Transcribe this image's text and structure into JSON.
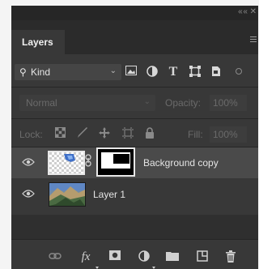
{
  "panel": {
    "title": "Layers",
    "collapse_icon": "double-chevron-right-icon",
    "menu_icon": "hamburger-icon"
  },
  "filter": {
    "kind_label": "Kind",
    "icons": [
      "image-filter-icon",
      "adjustment-filter-icon",
      "type-filter-icon",
      "shape-filter-icon",
      "smart-object-filter-icon"
    ]
  },
  "blending": {
    "mode": "Normal",
    "opacity_label": "Opacity:",
    "opacity_value": "100%"
  },
  "locks": {
    "label": "Lock:",
    "fill_label": "Fill:",
    "fill_value": "100%"
  },
  "layers": [
    {
      "name": "Background copy",
      "visible": true,
      "selected": true,
      "has_mask": true
    },
    {
      "name": "Layer 1",
      "visible": true,
      "selected": false,
      "has_mask": false
    }
  ],
  "footer": {
    "icons": [
      "link-layers-icon",
      "fx-icon",
      "add-mask-icon",
      "adjustment-layer-icon",
      "new-group-icon",
      "new-layer-icon",
      "delete-layer-icon"
    ],
    "fx_label": "fx"
  },
  "colors": {
    "panel_bg": "#383838",
    "selected_row": "#4a4a4a",
    "tab_bar": "#2b2b2b"
  }
}
